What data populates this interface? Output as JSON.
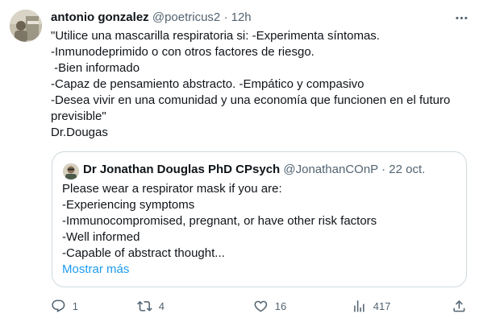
{
  "tweet": {
    "author_name": "antonio gonzalez",
    "author_handle": "@poetricus2",
    "dot": "·",
    "time": "12h",
    "lines": [
      "\"Utilice una mascarilla respiratoria si: -Experimenta síntomas.",
      "-Inmunodeprimido o con otros factores de riesgo.",
      " -Bien informado",
      "-Capaz de pensamiento abstracto. -Empático y compasivo",
      "-Desea vivir en una comunidad y una economía que funcionen en el futuro",
      "previsible\"",
      "Dr.Dougas"
    ]
  },
  "quote": {
    "author_name": "Dr Jonathan Douglas PhD CPsych",
    "author_handle": "@JonathanCOnP",
    "dot": "·",
    "time": "22 oct.",
    "lines": [
      "Please wear a respirator mask if you are:",
      "-Experiencing symptoms",
      "-Immunocompromised, pregnant, or have other risk factors",
      "-Well informed",
      "-Capable of abstract thought..."
    ],
    "show_more": "Mostrar más"
  },
  "actions": {
    "reply": {
      "icon": "reply-icon",
      "count": "1"
    },
    "retweet": {
      "icon": "retweet-icon",
      "count": "4"
    },
    "like": {
      "icon": "heart-icon",
      "count": "16"
    },
    "views": {
      "icon": "views-chart-icon",
      "count": "417"
    },
    "share": {
      "icon": "share-icon"
    }
  },
  "colors": {
    "text": "#0f1419",
    "secondary": "#536471",
    "link": "#1d9bf0",
    "border": "#cfd9de"
  }
}
